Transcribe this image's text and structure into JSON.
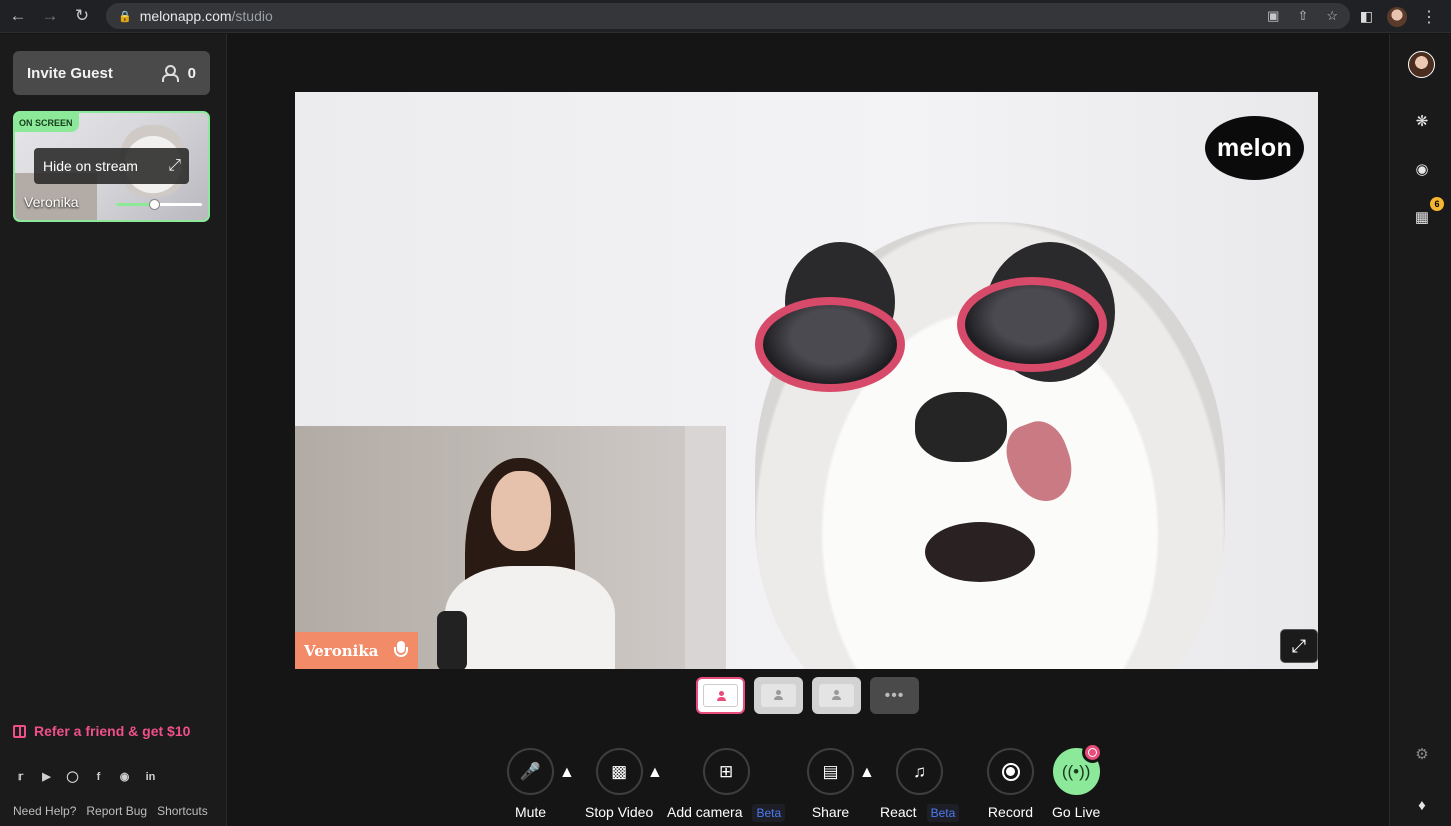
{
  "browser": {
    "url_host": "melonapp.com",
    "url_path": "/studio"
  },
  "sidebar": {
    "invite_label": "Invite Guest",
    "guest_count": "0",
    "tile": {
      "on_screen_label": "ON SCREEN",
      "hide_label": "Hide on stream",
      "name": "Veronika",
      "volume_level": 0.45
    },
    "refer_label": "Refer a friend & get $10",
    "socials": [
      "twitter",
      "youtube",
      "instagram",
      "facebook",
      "reddit",
      "linkedin"
    ],
    "footer_links": [
      "Need Help?",
      "Report Bug",
      "Shortcuts"
    ]
  },
  "stage": {
    "logo_text": "melon",
    "participant_name": "Veronika"
  },
  "layouts": {
    "active_index": 0,
    "count": 4
  },
  "controls": {
    "mute": "Mute",
    "stop_video": "Stop Video",
    "add_camera": "Add camera",
    "add_camera_badge": "Beta",
    "share": "Share",
    "react": "React",
    "react_badge": "Beta",
    "record": "Record",
    "go_live": "Go Live"
  },
  "right_rail": {
    "calendar_badge": "6"
  },
  "colors": {
    "accent_green": "#8ce99a",
    "accent_pink": "#e84c7a",
    "name_tag": "#f28b67",
    "beta_blue": "#4c7bf0"
  }
}
